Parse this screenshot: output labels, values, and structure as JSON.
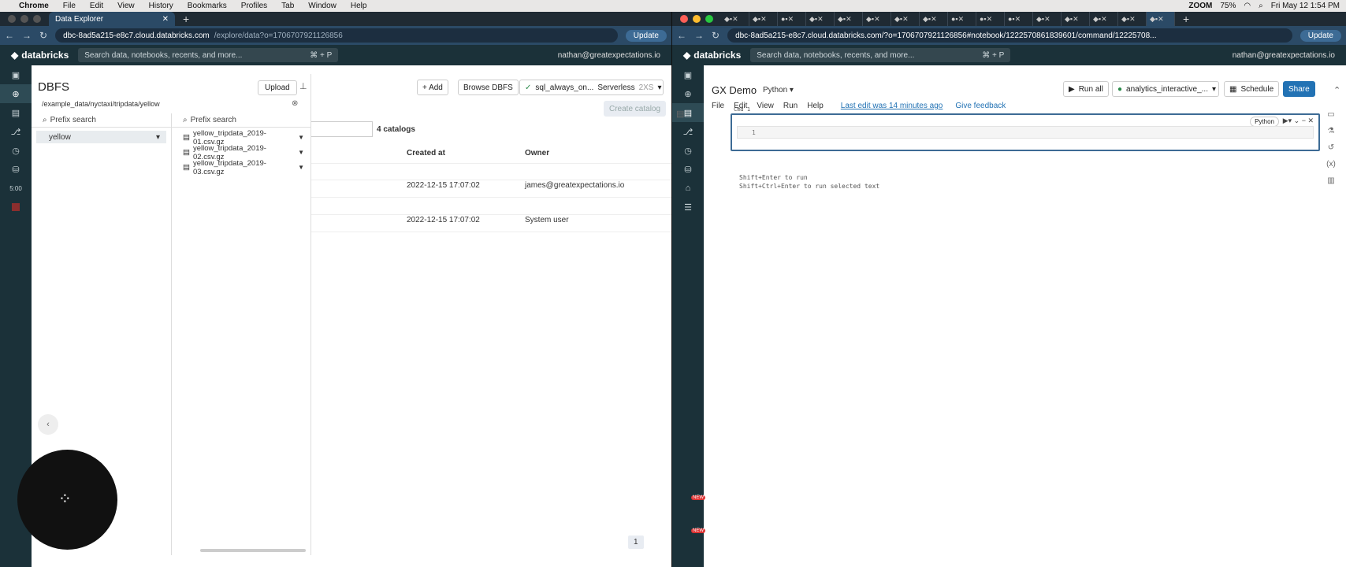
{
  "menubar": {
    "app": "Chrome",
    "items": [
      "File",
      "Edit",
      "View",
      "History",
      "Bookmarks",
      "Profiles",
      "Tab",
      "Window",
      "Help"
    ],
    "zoom": "ZOOM",
    "battery": "75%",
    "clock": "Fri May 12  1:54 PM"
  },
  "left": {
    "tab_title": "Data Explorer",
    "url_host": "dbc-8ad5a215-e8c7.cloud.databricks.com",
    "url_path": "/explore/data?o=1706707921126856",
    "update": "Update",
    "brand": "databricks",
    "search_placeholder": "Search data, notebooks, recents, and more...",
    "search_shortcut": "⌘ + P",
    "user": "nathan@greatexpectations.io",
    "timer": "5:00",
    "dbfs": {
      "title": "DBFS",
      "upload": "Upload",
      "path": "/example_data/nyctaxi/tripdata/yellow",
      "prefix_search": "Prefix search",
      "folder": "yellow",
      "files": [
        "yellow_tripdata_2019-01.csv.gz",
        "yellow_tripdata_2019-02.csv.gz",
        "yellow_tripdata_2019-03.csv.gz"
      ]
    },
    "toolbar": {
      "add": "+ Add",
      "browse": "Browse DBFS",
      "warehouse": "sql_always_on...",
      "serverless": "Serverless",
      "size": "2XS",
      "create": "Create catalog"
    },
    "catalogs_count": "4 catalogs",
    "table": {
      "headers": [
        "Created at",
        "Owner"
      ],
      "rows": [
        [
          "2022-12-15 17:07:02",
          "james@greatexpectations.io"
        ],
        [
          "2022-12-15 17:07:02",
          "System user"
        ]
      ]
    },
    "page": "1"
  },
  "right": {
    "url": "dbc-8ad5a215-e8c7.cloud.databricks.com/?o=1706707921126856#notebook/1222570861839601/command/12225708...",
    "update": "Update",
    "brand": "databricks",
    "search_placeholder": "Search data, notebooks, recents, and more...",
    "search_shortcut": "⌘ + P",
    "user": "nathan@greatexpectations.io",
    "notebook_title": "GX Demo",
    "language": "Python",
    "menu": [
      "File",
      "Edit",
      "View",
      "Run",
      "Help"
    ],
    "last_edit": "Last edit was 14 minutes ago",
    "feedback": "Give feedback",
    "run_all": "Run all",
    "cluster": "analytics_interactive_...",
    "schedule": "Schedule",
    "share": "Share",
    "cmd": "Cmd 1",
    "cell_lang": "Python",
    "line_no": "1",
    "hint1": "Shift+Enter to run",
    "hint2": "Shift+Ctrl+Enter to run selected text",
    "badge": "NEW"
  }
}
